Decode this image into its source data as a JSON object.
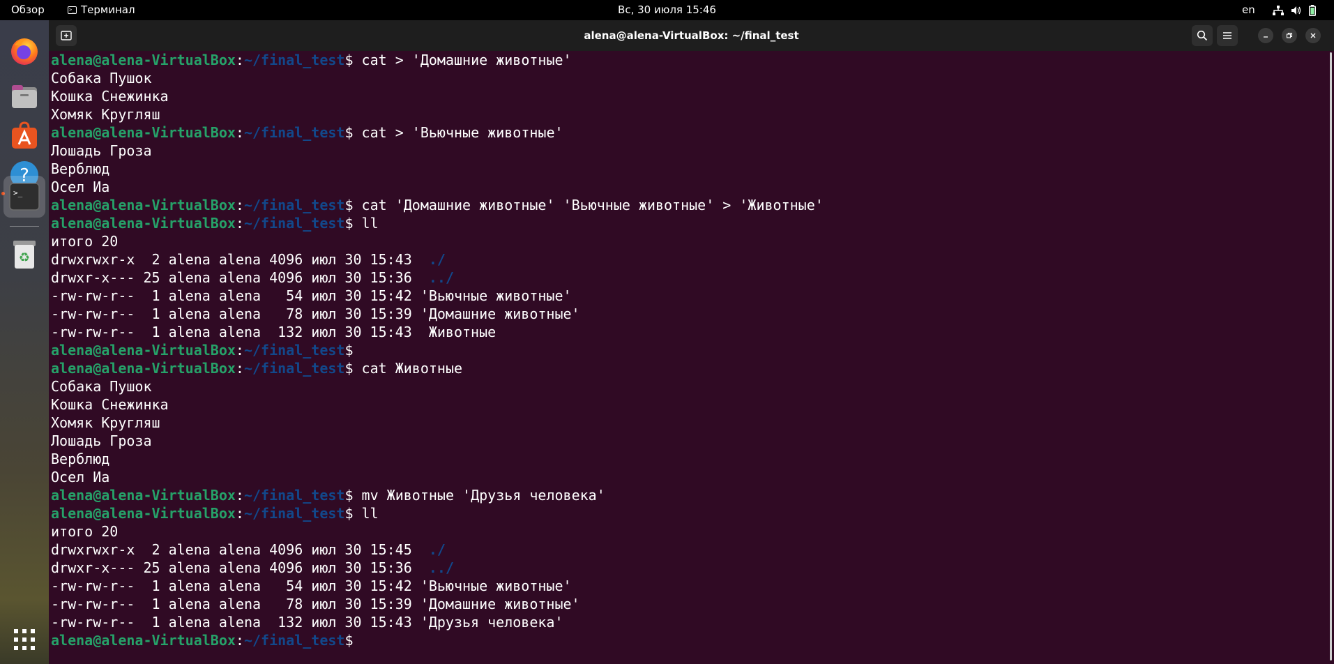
{
  "topbar": {
    "overview_label": "Обзор",
    "app_label": "Терминал",
    "clock": "Вс, 30 июля  15:46",
    "language": "en"
  },
  "dock": {
    "items": [
      {
        "name": "firefox-icon"
      },
      {
        "name": "files-icon"
      },
      {
        "name": "software-center-icon"
      },
      {
        "name": "help-icon"
      },
      {
        "name": "terminal-icon",
        "active": true
      },
      {
        "name": "trash-icon"
      },
      {
        "name": "app-grid-icon"
      }
    ]
  },
  "window": {
    "title": "alena@alena-VirtualBox: ~/final_test"
  },
  "prompt": {
    "user": "alena@alena-VirtualBox",
    "sep": ":",
    "path": "~/final_test",
    "dollar": "$"
  },
  "terminal_lines": [
    {
      "type": "cmd",
      "text": " cat > 'Домашние животные'"
    },
    {
      "type": "out",
      "text": "Собака Пушок"
    },
    {
      "type": "out",
      "text": "Кошка Снежинка"
    },
    {
      "type": "out",
      "text": "Хомяк Кругляш"
    },
    {
      "type": "cmd",
      "text": " cat > 'Вьючные животные'"
    },
    {
      "type": "out",
      "text": "Лошадь Гроза"
    },
    {
      "type": "out",
      "text": "Верблюд"
    },
    {
      "type": "out",
      "text": "Осел Иа"
    },
    {
      "type": "cmd",
      "text": " cat 'Домашние животные' 'Вьючные животные' > 'Животные'"
    },
    {
      "type": "cmd",
      "text": " ll"
    },
    {
      "type": "out",
      "text": "итого 20"
    },
    {
      "type": "dir",
      "text": "drwxrwxr-x  2 alena alena 4096 июл 30 15:43  ",
      "dir": "./"
    },
    {
      "type": "dir",
      "text": "drwxr-x--- 25 alena alena 4096 июл 30 15:36  ",
      "dir": "../"
    },
    {
      "type": "out",
      "text": "-rw-rw-r--  1 alena alena   54 июл 30 15:42 'Вьючные животные'"
    },
    {
      "type": "out",
      "text": "-rw-rw-r--  1 alena alena   78 июл 30 15:39 'Домашние животные'"
    },
    {
      "type": "out",
      "text": "-rw-rw-r--  1 alena alena  132 июл 30 15:43  Животные"
    },
    {
      "type": "cmd",
      "text": ""
    },
    {
      "type": "cmd",
      "text": " cat Животные"
    },
    {
      "type": "out",
      "text": "Собака Пушок"
    },
    {
      "type": "out",
      "text": "Кошка Снежинка"
    },
    {
      "type": "out",
      "text": "Хомяк Кругляш"
    },
    {
      "type": "out",
      "text": "Лошадь Гроза"
    },
    {
      "type": "out",
      "text": "Верблюд"
    },
    {
      "type": "out",
      "text": "Осел Иа"
    },
    {
      "type": "cmd",
      "text": " mv Животные 'Друзья человека'"
    },
    {
      "type": "cmd",
      "text": " ll"
    },
    {
      "type": "out",
      "text": "итого 20"
    },
    {
      "type": "dir",
      "text": "drwxrwxr-x  2 alena alena 4096 июл 30 15:45  ",
      "dir": "./"
    },
    {
      "type": "dir",
      "text": "drwxr-x--- 25 alena alena 4096 июл 30 15:36  ",
      "dir": "../"
    },
    {
      "type": "out",
      "text": "-rw-rw-r--  1 alena alena   54 июл 30 15:42 'Вьючные животные'"
    },
    {
      "type": "out",
      "text": "-rw-rw-r--  1 alena alena   78 июл 30 15:39 'Домашние животные'"
    },
    {
      "type": "out",
      "text": "-rw-rw-r--  1 alena alena  132 июл 30 15:43 'Друзья человека'"
    },
    {
      "type": "cmd",
      "text": ""
    }
  ],
  "colors": {
    "terminal_bg": "#300a24",
    "prompt_user": "#26a269",
    "prompt_path": "#12488b",
    "titlebar_bg": "#1e1e1e"
  }
}
